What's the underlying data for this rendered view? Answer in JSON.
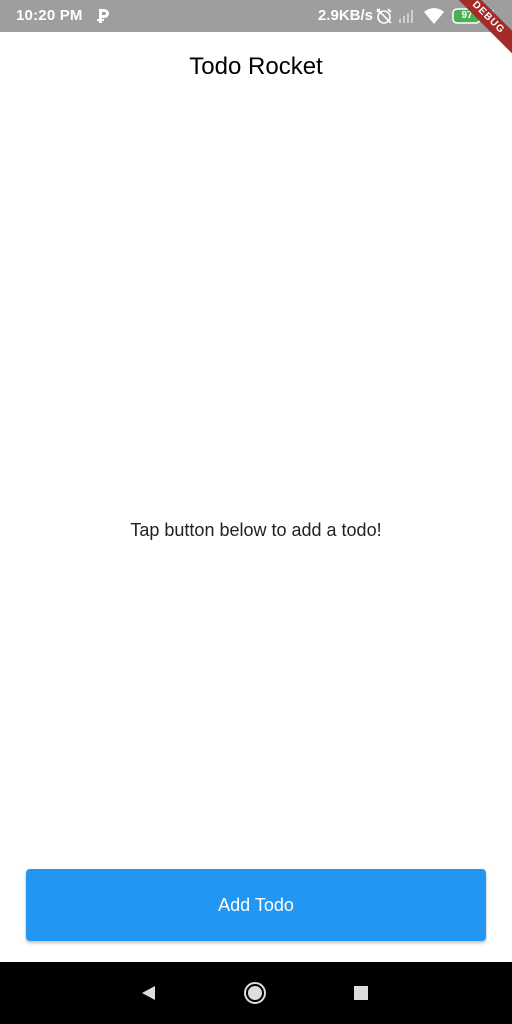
{
  "status_bar": {
    "time": "10:20 PM",
    "network_speed": "2.9KB/s",
    "battery_level": "97",
    "icons": [
      "p-icon",
      "alarm-off-icon",
      "signal-icon",
      "wifi-icon",
      "battery-icon",
      "charging-icon"
    ]
  },
  "debug_banner": "DEBUG",
  "app_bar": {
    "title": "Todo Rocket"
  },
  "body": {
    "empty_message": "Tap button below to add a todo!"
  },
  "add_button": {
    "label": "Add Todo"
  },
  "nav_bar": {
    "icons": [
      "back-icon",
      "home-icon",
      "recents-icon"
    ]
  },
  "colors": {
    "status_bar": "#9e9e9e",
    "primary": "#2196f3",
    "debug_banner": "#a52a2a",
    "nav_bar": "#000000"
  }
}
